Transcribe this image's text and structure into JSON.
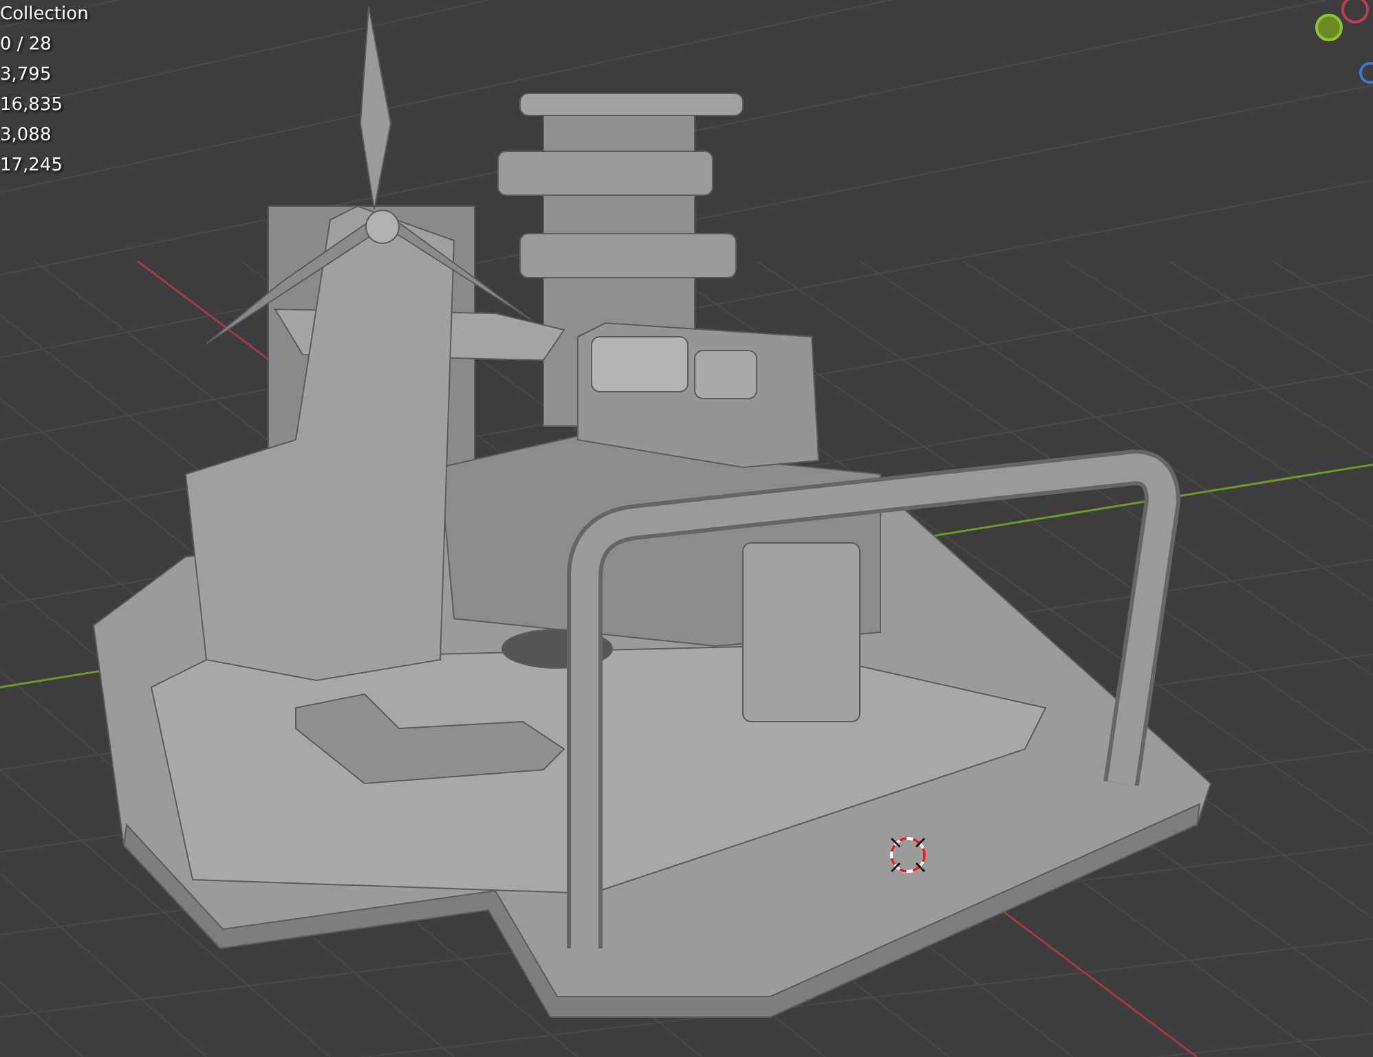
{
  "viewport": {
    "collection": "Collection",
    "stats": [
      "0 / 28",
      "3,795",
      "16,835",
      "3,088",
      "17,245"
    ]
  }
}
